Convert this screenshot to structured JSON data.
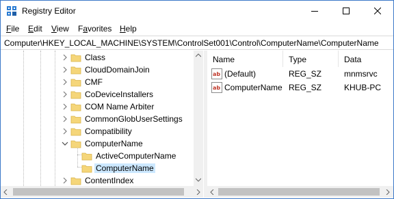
{
  "window": {
    "title": "Registry Editor"
  },
  "menu": {
    "file": {
      "label": "File",
      "key": "F",
      "rest": "ile"
    },
    "edit": {
      "label": "Edit",
      "key": "E",
      "rest": "dit"
    },
    "view": {
      "label": "View",
      "key": "V",
      "rest": "iew"
    },
    "favorites": {
      "label": "Favorites",
      "key": "a",
      "pre": "F",
      "rest": "vorites"
    },
    "help": {
      "label": "Help",
      "key": "H",
      "rest": "elp"
    }
  },
  "address": {
    "path": "Computer\\HKEY_LOCAL_MACHINE\\SYSTEM\\ControlSet001\\Control\\ComputerName\\ComputerName"
  },
  "tree": {
    "items": [
      {
        "label": "Class",
        "state": "collapsed"
      },
      {
        "label": "CloudDomainJoin",
        "state": "collapsed"
      },
      {
        "label": "CMF",
        "state": "collapsed"
      },
      {
        "label": "CoDeviceInstallers",
        "state": "collapsed"
      },
      {
        "label": "COM Name Arbiter",
        "state": "collapsed"
      },
      {
        "label": "CommonGlobUserSettings",
        "state": "collapsed"
      },
      {
        "label": "Compatibility",
        "state": "collapsed"
      },
      {
        "label": "ComputerName",
        "state": "expanded"
      },
      {
        "label": "ActiveComputerName",
        "state": "leaf"
      },
      {
        "label": "ComputerName",
        "state": "selected"
      },
      {
        "label": "ContentIndex",
        "state": "collapsed"
      }
    ]
  },
  "list": {
    "columns": {
      "name": "Name",
      "type": "Type",
      "data": "Data"
    },
    "rows": [
      {
        "name": "(Default)",
        "type": "REG_SZ",
        "data": "mnmsrvc",
        "icon": "string-value-icon"
      },
      {
        "name": "ComputerName",
        "type": "REG_SZ",
        "data": "KHUB-PC",
        "icon": "string-value-icon"
      }
    ]
  },
  "colors": {
    "selection": "#cce8ff",
    "folder": "#f5d67a",
    "value_icon_red": "#c0392b"
  }
}
